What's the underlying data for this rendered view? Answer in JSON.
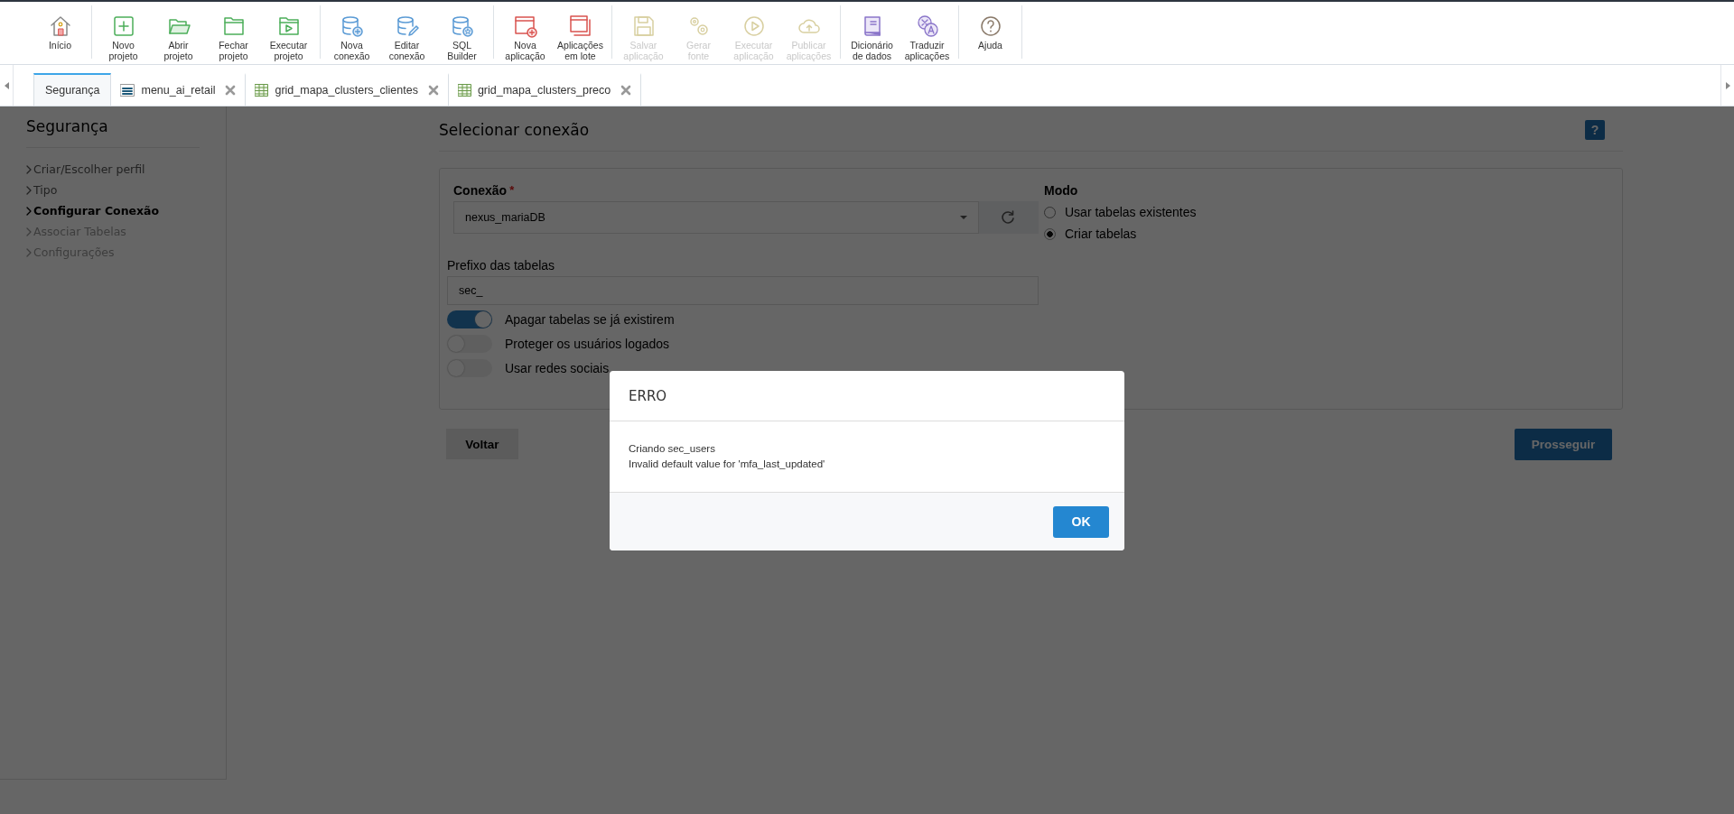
{
  "toolbar": {
    "groups": [
      {
        "items": [
          {
            "label": "Início",
            "disabled": false
          }
        ]
      },
      {
        "items": [
          {
            "label": "Novo\nprojeto",
            "disabled": false
          },
          {
            "label": "Abrir\nprojeto",
            "disabled": false
          },
          {
            "label": "Fechar\nprojeto",
            "disabled": false
          },
          {
            "label": "Executar\nprojeto",
            "disabled": false
          }
        ]
      },
      {
        "items": [
          {
            "label": "Nova\nconexão",
            "disabled": false
          },
          {
            "label": "Editar\nconexão",
            "disabled": false
          },
          {
            "label": "SQL\nBuilder",
            "disabled": false
          }
        ]
      },
      {
        "items": [
          {
            "label": "Nova\naplicação",
            "disabled": false
          },
          {
            "label": "Aplicações\nem lote",
            "disabled": false
          }
        ]
      },
      {
        "items": [
          {
            "label": "Salvar\naplicação",
            "disabled": true
          },
          {
            "label": "Gerar\nfonte",
            "disabled": true
          },
          {
            "label": "Executar\naplicação",
            "disabled": true
          },
          {
            "label": "Publicar\naplicações",
            "disabled": true
          }
        ]
      },
      {
        "items": [
          {
            "label": "Dicionário\nde dados",
            "disabled": false
          },
          {
            "label": "Traduzir\naplicações",
            "disabled": false
          }
        ]
      },
      {
        "items": [
          {
            "label": "Ajuda",
            "disabled": false
          }
        ]
      }
    ]
  },
  "tabs": [
    {
      "label": "Segurança",
      "kind": "plain",
      "closable": false,
      "selected": true
    },
    {
      "label": "menu_ai_retail",
      "kind": "menu",
      "closable": true,
      "selected": false
    },
    {
      "label": "grid_mapa_clusters_clientes",
      "kind": "grid",
      "closable": true,
      "selected": false
    },
    {
      "label": "grid_mapa_clusters_preco",
      "kind": "grid",
      "closable": true,
      "selected": false
    }
  ],
  "sidebar": {
    "title": "Segurança",
    "steps": [
      {
        "label": "Criar/Escolher perfil",
        "selected": false,
        "disabled": false
      },
      {
        "label": "Tipo",
        "selected": false,
        "disabled": false
      },
      {
        "label": "Configurar Conexão",
        "selected": true,
        "disabled": false
      },
      {
        "label": "Associar Tabelas",
        "selected": false,
        "disabled": true
      },
      {
        "label": "Configurações",
        "selected": false,
        "disabled": true
      }
    ]
  },
  "main": {
    "title": "Selecionar conexão",
    "help": "?",
    "connection": {
      "label": "Conexão",
      "required_mark": "*",
      "value": "nexus_mariaDB"
    },
    "mode": {
      "label": "Modo",
      "options": [
        {
          "label": "Usar tabelas existentes",
          "selected": false
        },
        {
          "label": "Criar tabelas",
          "selected": true
        }
      ]
    },
    "prefix": {
      "label": "Prefixo das tabelas",
      "value": "sec_"
    },
    "toggles": [
      {
        "label": "Apagar tabelas se já existirem",
        "on": true
      },
      {
        "label": "Proteger os usuários logados",
        "on": false
      },
      {
        "label": "Usar redes sociais",
        "on": false
      }
    ],
    "back_button": "Voltar",
    "next_button": "Prosseguir"
  },
  "dialog": {
    "title": "ERRO",
    "lines": [
      "Criando sec_users",
      "Invalid default value for 'mfa_last_updated'"
    ],
    "button": "OK"
  }
}
